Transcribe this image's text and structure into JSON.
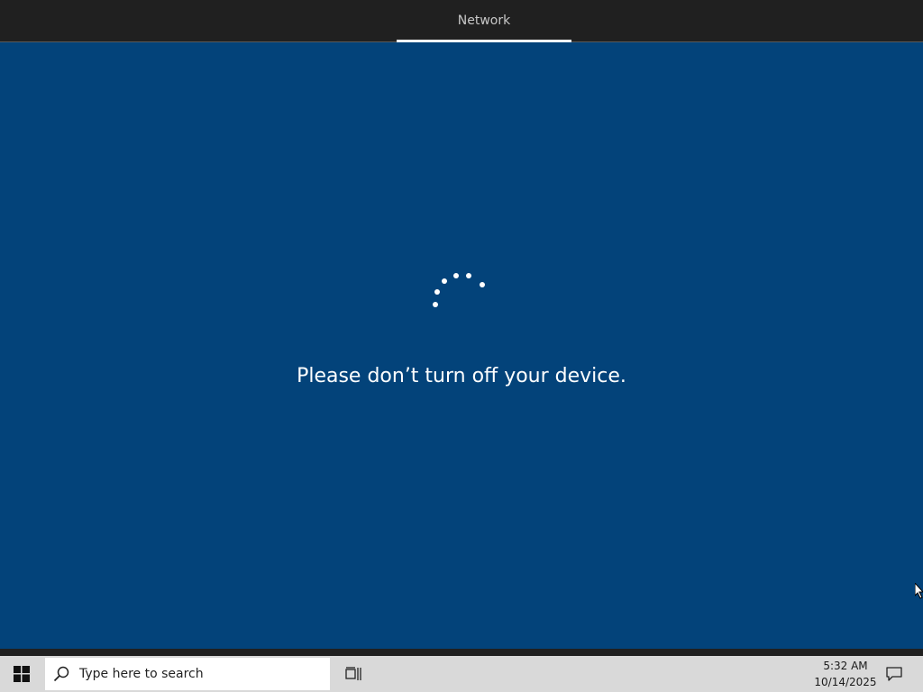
{
  "topbar": {
    "tabs": [
      {
        "label": "Network",
        "selected": true
      }
    ]
  },
  "main": {
    "message": "Please don’t turn off your device.",
    "background_color": "#03437a",
    "spinner_icon": "progress-ring-icon"
  },
  "taskbar": {
    "start_icon": "windows-logo-icon",
    "search": {
      "placeholder": "Type here to search",
      "icon": "search-icon"
    },
    "taskview_icon": "task-view-icon",
    "clock": {
      "time": "5:32 AM",
      "date": "10/14/2025"
    },
    "notification_icon": "action-center-icon"
  }
}
